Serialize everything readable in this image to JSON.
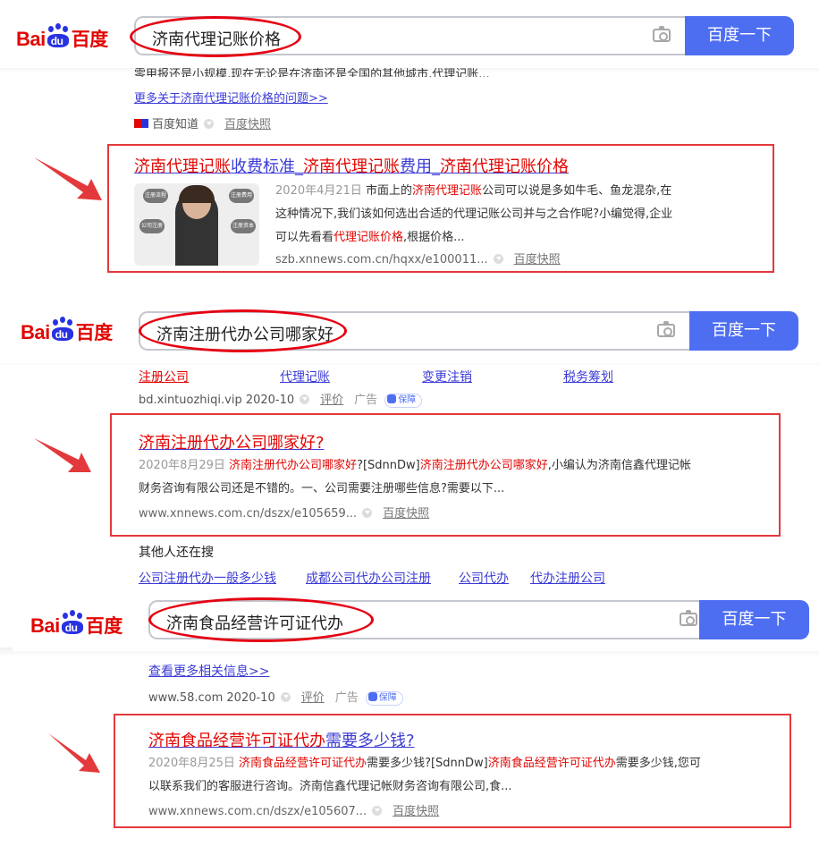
{
  "logo": {
    "bai": "Bai",
    "du": "du",
    "cn": "百度"
  },
  "search_button_label": "百度一下",
  "panels": [
    {
      "query": "济南代理记账价格",
      "prev": {
        "partial_text": "零甲报还是小规模,现在无论是在济南还是全国的其他城市,代理记账...",
        "more_link": "更多关于济南代理记账价格的问题>>",
        "source_name": "百度知道",
        "snapshot": "百度快照"
      },
      "result": {
        "title_parts": [
          "济南代理记账",
          "收费标准_",
          "济南代理记账",
          "费用_",
          "济南代理记账价格"
        ],
        "date": "2020年4月21日",
        "snippet": [
          " 市面上的",
          "济南代理记账",
          "公司可以说是多如牛毛、鱼龙混杂,在这种情况下,我们该如何选出合适的代理记账公司并与之合作呢?小编觉得,企业可以先看看",
          "代理记账价格",
          ",根据价格..."
        ],
        "thumb_labels": [
          "注册流程",
          "公司注册",
          "注册费用",
          "注册资本"
        ],
        "url": "szb.xnnews.com.cn/hqxx/e100011...",
        "snapshot": "百度快照"
      }
    },
    {
      "query": "济南注册代办公司哪家好",
      "prev": {
        "sitelinks": [
          "注册公司",
          "代理记账",
          "变更注销",
          "税务筹划"
        ],
        "source": "bd.xintuozhiqi.vip 2020-10",
        "review": "评价",
        "ad": "广告",
        "guarantee": "保障"
      },
      "result": {
        "title": "济南注册代办公司哪家好?",
        "date": "2020年8月29日",
        "snippet": [
          " ",
          "济南注册代办公司哪家好",
          "?[SdnnDw]",
          "济南注册代办公司哪家好",
          ",小编认为济南信鑫代理记帐财务咨询有限公司还是不错的。一、公司需要注册哪些信息?需要以下..."
        ],
        "url": "www.xnnews.com.cn/dszx/e105659...",
        "snapshot": "百度快照"
      },
      "others": {
        "heading": "其他人还在搜",
        "links": [
          "公司注册代办一般多少钱",
          "成都公司代办公司注册",
          "公司代办",
          "代办注册公司"
        ]
      }
    },
    {
      "query": "济南食品经营许可证代办",
      "prev": {
        "more_link": "查看更多相关信息>>",
        "source": "www.58.com 2020-10",
        "review": "评价",
        "ad": "广告",
        "guarantee": "保障"
      },
      "result": {
        "title_parts": [
          "济南食品经营许可证代办",
          "需要多少钱?"
        ],
        "date": "2020年8月25日",
        "snippet": [
          " ",
          "济南食品经营许可证代办",
          "需要多少钱?[SdnnDw]",
          "济南食品经营许可证代办",
          "需要多少钱,您可以联系我们的客服进行咨询。济南信鑫代理记帐财务咨询有限公司,食..."
        ],
        "url": "www.xnnews.com.cn/dszx/e105607...",
        "snapshot": "百度快照"
      }
    }
  ],
  "colors": {
    "accent": "#4e6ef2",
    "highlight": "#e10602",
    "annotation": "#e3393c",
    "link": "#3b3bd6"
  }
}
